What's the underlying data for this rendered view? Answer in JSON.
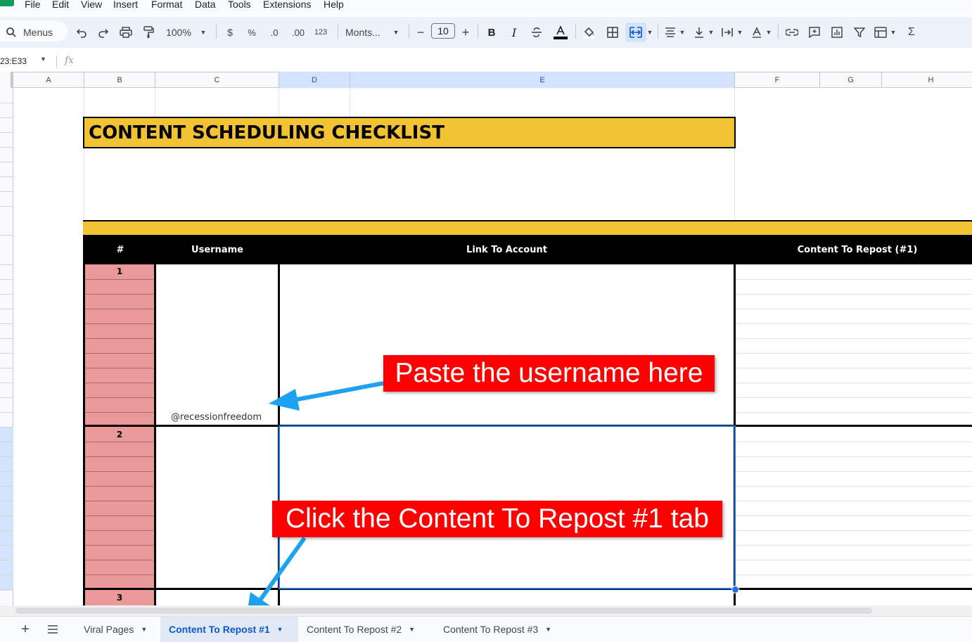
{
  "menu": [
    "File",
    "Edit",
    "View",
    "Insert",
    "Format",
    "Data",
    "Tools",
    "Extensions",
    "Help"
  ],
  "toolbar": {
    "menus_label": "Menus",
    "zoom": "100%",
    "currency": "$",
    "percent": "%",
    "dec_decrease": ".0",
    "dec_increase": ".00",
    "number_format": "123",
    "font": "Monts...",
    "font_size": "10",
    "bold": "B",
    "italic": "I",
    "sum": "Σ"
  },
  "formula_bar": {
    "name_box": "23:E33",
    "fx": "fx"
  },
  "columns": [
    "A",
    "B",
    "C",
    "D",
    "E",
    "F",
    "G",
    "H"
  ],
  "sheet": {
    "title": "CONTENT SCHEDULING CHECKLIST",
    "headers": {
      "num": "#",
      "username": "Username",
      "link": "Link To Account",
      "content": "Content To Repost (#1)"
    },
    "row_numbers": [
      "1",
      "2",
      "3"
    ],
    "username_value": "@recessionfreedom"
  },
  "annotations": {
    "paste": "Paste the username here",
    "click": "Click the Content To Repost #1 tab"
  },
  "tabs": [
    {
      "label": "Viral Pages",
      "active": false
    },
    {
      "label": "Content To Repost #1",
      "active": true
    },
    {
      "label": "Content To Repost #2",
      "active": false
    },
    {
      "label": "Content To Repost #3",
      "active": false
    }
  ],
  "colors": {
    "title_yellow": "#f1c232",
    "row_pink": "#ea9999",
    "callout_red": "#ff0000",
    "arrow_blue": "#1da1f2",
    "selection_blue": "#1a73e8"
  }
}
